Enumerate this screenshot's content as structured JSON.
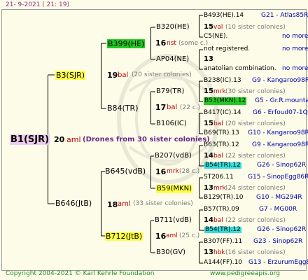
{
  "header": {
    "timestamp": "21-  9-2021 (  21: 19)"
  },
  "footer": {
    "copyright": "Copyright 2004-2021 © Karl Kehrle Foundation",
    "url": "www.pedigreeapis.org"
  },
  "root": {
    "name": "B1(SJR)",
    "year": "20",
    "breed": "aml",
    "note": "(Drones from 30 sister colonies)"
  },
  "g1": {
    "upper": {
      "name": "B3(SJR)",
      "year": "19",
      "breed": "bal",
      "note": "(20 sister colonies)"
    },
    "lower": {
      "name": "B646(JtB)",
      "year": "18",
      "breed": "aml",
      "note": "(33 sister colonies)"
    }
  },
  "g2": {
    "a": {
      "name": "B399(HE)",
      "year": "16",
      "breed": "nst",
      "note": "(some c.)"
    },
    "b": {
      "name": "B84(TR)",
      "year": "17",
      "breed": "bal",
      "note": "(22 c.)"
    },
    "c": {
      "name": "B645(vdB)",
      "year": "16",
      "breed": "mrk",
      "note": "(28 c.)"
    },
    "d": {
      "name": "B712(JtB)",
      "year": "16",
      "breed": "aml",
      "note": "(25 c.)"
    }
  },
  "g3": [
    {
      "name": "B320(HE)",
      "year": "15",
      "breed": "val",
      "note": "(10 sister colonies)"
    },
    {
      "name": "AP04(NE)",
      "year": "13",
      "breed": "",
      "note": ""
    },
    {
      "name": "B79(TR)",
      "year": "15",
      "breed": "mrk",
      "note": "(30 sister colonies)"
    },
    {
      "name": "B106(IC)",
      "year": "15",
      "breed": "bal",
      "note": "(20 sister colonies)"
    },
    {
      "name": "B207(vdB)",
      "year": "14",
      "breed": "bal",
      "note": "(22 sister colonies)"
    },
    {
      "name": "B59(MKN)",
      "year": "13",
      "breed": "mrk",
      "note": "(24 sister colonies)"
    },
    {
      "name": "B711(vdB)",
      "year": "14",
      "breed": "bal",
      "note": "(22 sister colonies)"
    },
    {
      "name": "B30(GV)",
      "year": "13",
      "breed": "hbk",
      "note": "(16 sister colonies)"
    }
  ],
  "g4": [
    {
      "name": "B493(HE).14",
      "nav": "G21 - Atlas85R"
    },
    {
      "name": "C5(NE).",
      "nav": "no more"
    },
    {
      "name": "not registered.",
      "nav": "no more"
    },
    {
      "name": "anatolian combination.",
      "nav": "no more"
    },
    {
      "name": "B238(IC).13",
      "nav": "G9 - Kangaroo98R"
    },
    {
      "name": "B53(MKN).12",
      "nav": "G5 - Gr.R.mounta"
    },
    {
      "name": "B417(IC).14",
      "nav": "G6 - Erfoud07-1Q"
    },
    {
      "name": "B69(TR).13",
      "nav": "G10 - Kangaroo98R"
    },
    {
      "name": "B63(TR).12",
      "nav": "G9 - Kangaroo98R"
    },
    {
      "name": "B54(TR).12",
      "nav": "G26 - Sinop62R"
    },
    {
      "name": "ST206.11",
      "nav": "G15 - SinopEgg86R"
    },
    {
      "name": "B129(TR).10",
      "nav": "G10 - MG294R"
    },
    {
      "name": "B57(TR).09",
      "nav": "G7 - MG00R"
    },
    {
      "name": "B54(TR).12",
      "nav": "G26 - Sinop62R"
    },
    {
      "name": "B307(FF).11",
      "nav": "G23 - Sinop62R"
    },
    {
      "name": "A144(FF).10",
      "nav": "G13 - ErzurumEgg8"
    }
  ],
  "colors": {
    "background": "#fcfce8",
    "yellow": "#ffff44",
    "green": "#22cc22",
    "cyan": "#33dddd",
    "violet": "#eeccee",
    "breed_red": "#c00000",
    "nav_blue": "#0000aa"
  }
}
